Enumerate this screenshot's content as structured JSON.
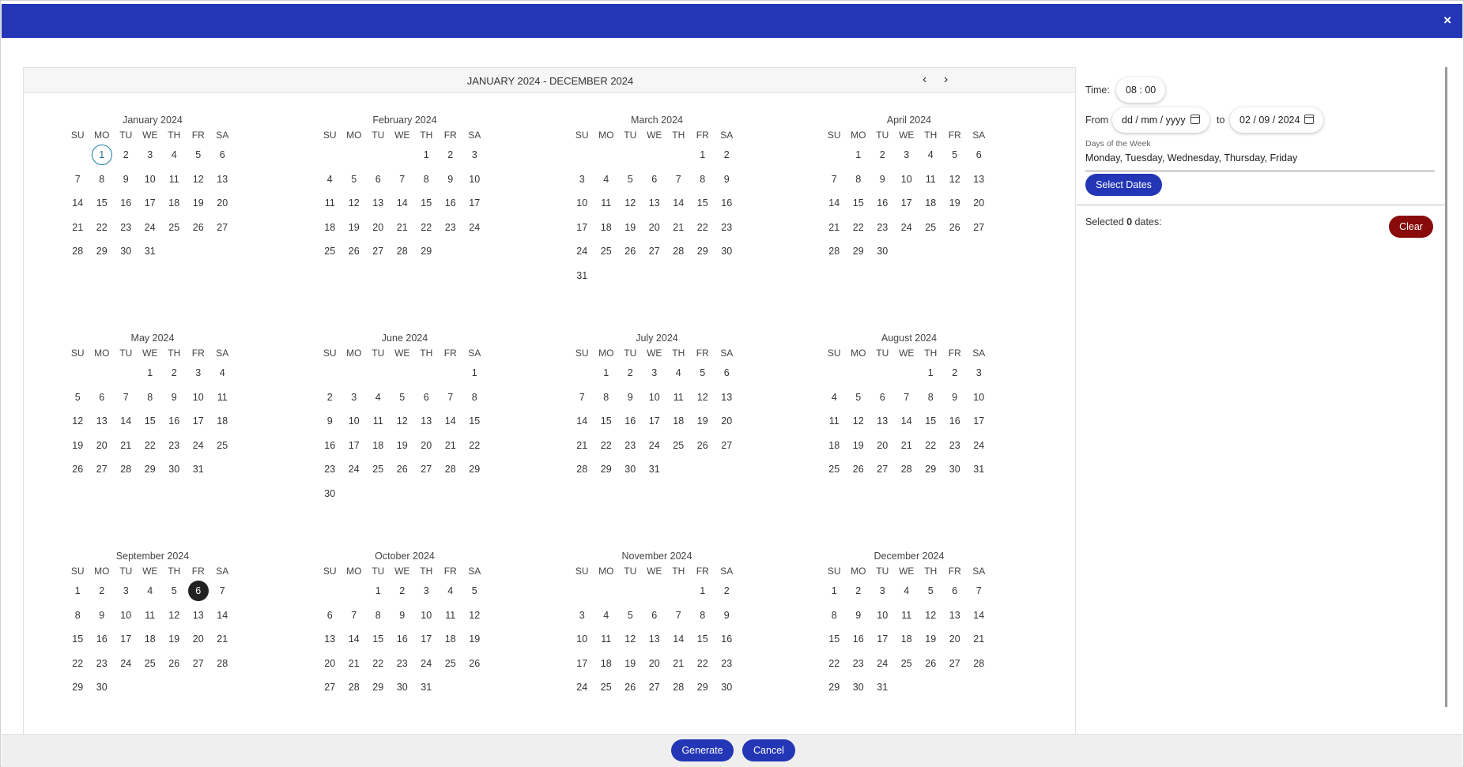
{
  "dialog": {
    "close_label": "×"
  },
  "calendar": {
    "range_title": "JANUARY 2024 - DECEMBER 2024",
    "prev_label": "‹",
    "next_label": "›",
    "weekdays": [
      "SU",
      "MO",
      "TU",
      "WE",
      "TH",
      "FR",
      "SA"
    ],
    "months": [
      {
        "name": "January 2024",
        "offset": 1,
        "days": 31
      },
      {
        "name": "February 2024",
        "offset": 4,
        "days": 29
      },
      {
        "name": "March 2024",
        "offset": 5,
        "days": 31
      },
      {
        "name": "April 2024",
        "offset": 1,
        "days": 30
      },
      {
        "name": "May 2024",
        "offset": 3,
        "days": 31
      },
      {
        "name": "June 2024",
        "offset": 6,
        "days": 30
      },
      {
        "name": "July 2024",
        "offset": 1,
        "days": 31
      },
      {
        "name": "August 2024",
        "offset": 4,
        "days": 31
      },
      {
        "name": "September 2024",
        "offset": 0,
        "days": 30
      },
      {
        "name": "October 2024",
        "offset": 2,
        "days": 31
      },
      {
        "name": "November 2024",
        "offset": 5,
        "days": 30
      },
      {
        "name": "December 2024",
        "offset": 0,
        "days": 31
      }
    ],
    "today": {
      "month": 0,
      "day": 1
    },
    "selected": {
      "month": 8,
      "day": 6
    }
  },
  "settings": {
    "time_label": "Time:",
    "time_value": "08 : 00",
    "from_label": "From",
    "from_value": "dd / mm / yyyy",
    "to_label": "to",
    "to_value": "02 / 09 / 2024",
    "dow_label": "Days of the Week",
    "dow_value": "Monday, Tuesday, Wednesday, Thursday, Friday",
    "select_dates_label": "Select Dates"
  },
  "summary": {
    "prefix": "Selected ",
    "count": "0",
    "suffix": " dates:",
    "clear_label": "Clear"
  },
  "footer": {
    "generate_label": "Generate",
    "cancel_label": "Cancel"
  },
  "colors": {
    "primary": "#2336b5",
    "danger": "#8a0b0b",
    "today_ring": "#1f7ea8",
    "selected_fill": "#222222"
  }
}
